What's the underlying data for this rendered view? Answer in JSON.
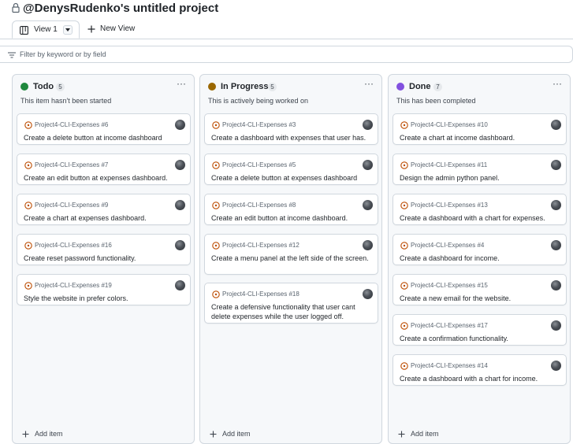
{
  "project": {
    "title": "@DenysRudenko's untitled project"
  },
  "tabs": {
    "view1_label": "View 1",
    "new_view_label": "New View"
  },
  "filter": {
    "placeholder": "Filter by keyword or by field",
    "value": ""
  },
  "icons": {
    "lock": "lock-icon",
    "board": "project-board-icon",
    "chevron": "chevron-down-icon",
    "plus": "plus-icon",
    "filter": "filter-lines-icon",
    "draft": "issue-draft-icon",
    "more": "kebab-horizontal-icon",
    "avatar": "user-avatar"
  },
  "colors": {
    "todo": "#1f883d",
    "in_progress": "#9a6700",
    "done": "#8250df",
    "draft_icon": "#bc4c00"
  },
  "columns": [
    {
      "name": "Todo",
      "count": "5",
      "color": "#1f883d",
      "description": "This item hasn't been started",
      "add_label": "Add item",
      "cards": [
        {
          "ref": "Project4-CLI-Expenses #6",
          "title": "Create a delete button at income dashboard"
        },
        {
          "ref": "Project4-CLI-Expenses #7",
          "title": "Create an edit button at expenses dashboard."
        },
        {
          "ref": "Project4-CLI-Expenses #9",
          "title": "Create a chart at expenses dashboard."
        },
        {
          "ref": "Project4-CLI-Expenses #16",
          "title": "Create reset password functionality."
        },
        {
          "ref": "Project4-CLI-Expenses #19",
          "title": "Style the website in prefer colors."
        }
      ]
    },
    {
      "name": "In Progress",
      "count": "5",
      "color": "#9a6700",
      "description": "This is actively being worked on",
      "add_label": "Add item",
      "cards": [
        {
          "ref": "Project4-CLI-Expenses #3",
          "title": "Create a dashboard with expenses that user has."
        },
        {
          "ref": "Project4-CLI-Expenses #5",
          "title": "Create a delete button at expenses dashboard"
        },
        {
          "ref": "Project4-CLI-Expenses #8",
          "title": "Create an edit button at income dashboard."
        },
        {
          "ref": "Project4-CLI-Expenses #12",
          "title": "Create a menu panel at the left side of the screen."
        },
        {
          "ref": "Project4-CLI-Expenses #18",
          "title": "Create a defensive functionality that user cant delete expenses while the user logged off."
        }
      ]
    },
    {
      "name": "Done",
      "count": "7",
      "color": "#8250df",
      "description": "This has been completed",
      "add_label": "Add item",
      "cards": [
        {
          "ref": "Project4-CLI-Expenses #10",
          "title": "Create a chart at income dashboard."
        },
        {
          "ref": "Project4-CLI-Expenses #11",
          "title": "Design the admin python panel."
        },
        {
          "ref": "Project4-CLI-Expenses #13",
          "title": "Create a dashboard with a chart for expenses."
        },
        {
          "ref": "Project4-CLI-Expenses #4",
          "title": "Create a dashboard for income."
        },
        {
          "ref": "Project4-CLI-Expenses #15",
          "title": "Create a new email for the website."
        },
        {
          "ref": "Project4-CLI-Expenses #17",
          "title": "Create a confirmation functionality."
        },
        {
          "ref": "Project4-CLI-Expenses #14",
          "title": "Create a dashboard with a chart for income."
        }
      ]
    }
  ]
}
